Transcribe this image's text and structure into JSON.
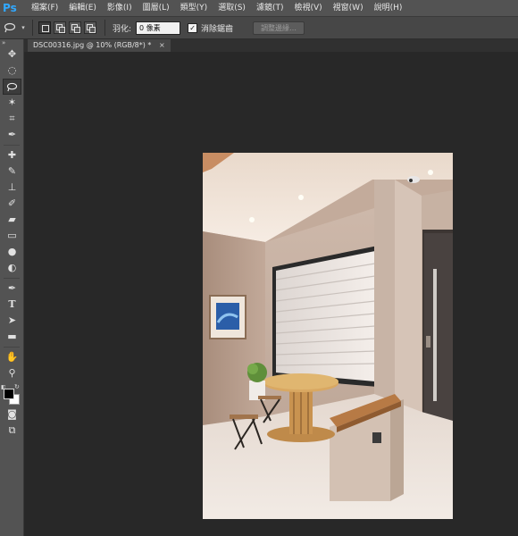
{
  "app": {
    "logo": "Ps"
  },
  "menu": [
    "檔案(F)",
    "編輯(E)",
    "影像(I)",
    "圖層(L)",
    "類型(Y)",
    "選取(S)",
    "濾鏡(T)",
    "檢視(V)",
    "視窗(W)",
    "說明(H)"
  ],
  "options": {
    "tool_icon": "lasso-icon",
    "feather_label": "羽化:",
    "feather_value": "0 像素",
    "antialias_checked": true,
    "antialias_label": "消除鋸齒",
    "refine_label": "調整邊緣…"
  },
  "document": {
    "tab_title": "DSC00316.jpg @ 10% (RGB/8*) *",
    "close_glyph": "×"
  },
  "tools": [
    "move-tool",
    "marquee-tool",
    "lasso-tool",
    "quick-selection-tool",
    "crop-tool",
    "eyedropper-tool",
    "spot-healing-tool",
    "brush-tool",
    "clone-stamp-tool",
    "history-brush-tool",
    "eraser-tool",
    "gradient-tool",
    "blur-tool",
    "dodge-tool",
    "pen-tool",
    "type-tool",
    "path-selection-tool",
    "shape-tool",
    "hand-tool",
    "zoom-tool",
    "quick-mask-tool",
    "screen-mode-tool"
  ],
  "colors": {
    "foreground": "#000000",
    "background": "#ffffff",
    "accent": "#31a8ff"
  }
}
